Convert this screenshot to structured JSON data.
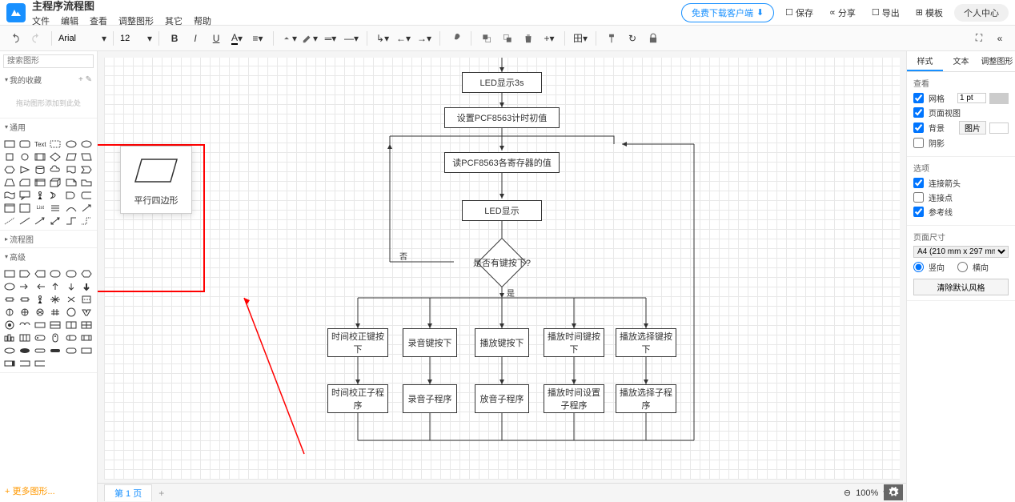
{
  "header": {
    "doc_title": "主程序流程图",
    "menu": [
      "文件",
      "编辑",
      "查看",
      "调整图形",
      "其它",
      "帮助"
    ],
    "download_btn": "免费下载客户端",
    "save": "保存",
    "share": "分享",
    "export": "导出",
    "templates": "模板",
    "user": "个人中心"
  },
  "toolbar": {
    "font": "Arial",
    "size": "12"
  },
  "sidebar_left": {
    "search_placeholder": "搜索图形",
    "favorites": "我的收藏",
    "favorites_empty": "拖动图形添加到此处",
    "general": "通用",
    "flowchart": "流程图",
    "advanced": "高级",
    "more_shapes": "+ 更多图形..."
  },
  "tooltip": {
    "shape_name": "平行四边形"
  },
  "flowchart": {
    "node1": "LED显示3s",
    "node2": "设置PCF8563计时初值",
    "node3": "读PCF8563各寄存器的值",
    "node4": "LED显示",
    "decision": "是否有键按下?",
    "label_no": "否",
    "label_yes": "是",
    "branch1_a": "时间校正键按下",
    "branch1_b": "时间校正子程序",
    "branch2_a": "录音键按下",
    "branch2_b": "录音子程序",
    "branch3_a": "播放键按下",
    "branch3_b": "放音子程序",
    "branch4_a": "播放时间键按下",
    "branch4_b": "播放时间设置子程序",
    "branch5_a": "播放选择键按下",
    "branch5_b": "播放选择子程序"
  },
  "pagetabs": {
    "page1": "第 1 页",
    "zoom": "100%"
  },
  "sidebar_right": {
    "tabs": [
      "样式",
      "文本",
      "调整图形"
    ],
    "view_title": "查看",
    "grid": "网格",
    "grid_size": "1 pt",
    "page_view": "页面视图",
    "background": "背景",
    "bg_btn": "图片",
    "shadow": "阴影",
    "options_title": "选项",
    "arrow_head": "连接箭头",
    "connect_points": "连接点",
    "guides": "参考线",
    "page_size_title": "页面尺寸",
    "page_size_value": "A4 (210 mm x 297 mm)",
    "orient_portrait": "竖向",
    "orient_landscape": "横向",
    "clear_style": "清除默认风格"
  }
}
